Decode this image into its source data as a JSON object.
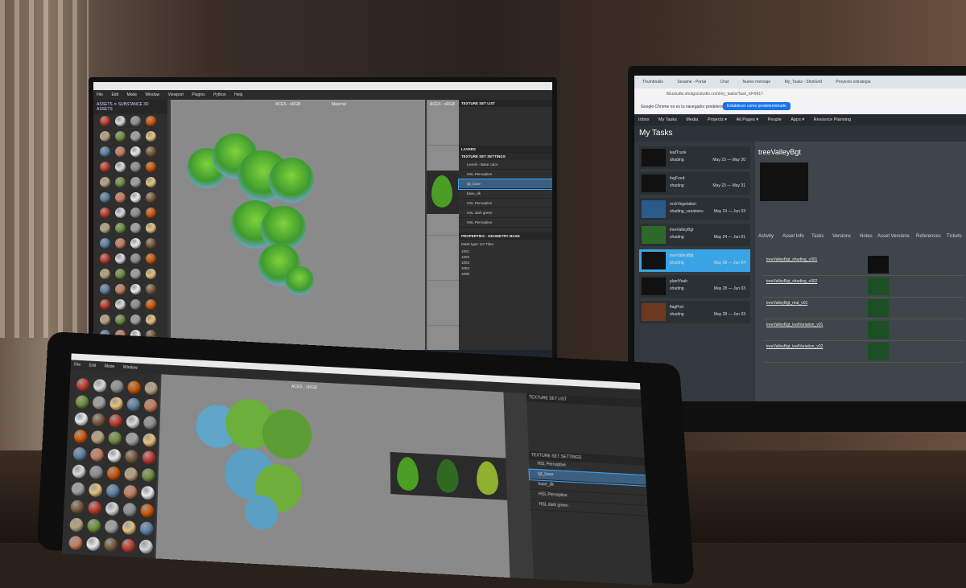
{
  "painter": {
    "menu": [
      "File",
      "Edit",
      "Mode",
      "Window",
      "Viewport",
      "Plugins",
      "Python",
      "Help"
    ],
    "shelf_tabs": "ASSETS ✕   SUBSTANCE 3D ASSETS",
    "panel_titles": {
      "texture_set": "TEXTURE SET LIST",
      "layers": "LAYERS",
      "settings": "TEXTURE SET SETTINGS",
      "properties": "PROPERTIES - GEOMETRY MASK"
    },
    "viewport_label": "ACES - sRGB",
    "view_mode": "Material",
    "layers": [
      {
        "name": "Levels - Base color",
        "selected": false
      },
      {
        "name": "HSL Perceptive",
        "selected": false
      },
      {
        "name": "lgt_base",
        "selected": true
      },
      {
        "name": "base_dk",
        "selected": false
      },
      {
        "name": "HSL Perceptive",
        "selected": false
      },
      {
        "name": "HSL dark green",
        "selected": false
      },
      {
        "name": "HSL Perceptive",
        "selected": false
      }
    ],
    "mesh_type": "Mask type:   UV Tiles",
    "tiles": [
      "1001",
      "1002",
      "1003",
      "1004",
      "1005"
    ]
  },
  "shotgrid": {
    "browser_tabs": [
      "Thumbnails",
      "Sesame - Portal",
      "Chat",
      "Nuevo mensaje",
      "My_Tasks - ShotGrid",
      "Proyecto estrategia"
    ],
    "address": "tblustudio.shotgunstudio.com/my_tasks/Task_Id=9617",
    "infobar_text": "Google Chrome no es tu navegador predeterminado",
    "infobar_button": "Establecer como predeterminado",
    "nav": [
      "Inbox",
      "My Tasks",
      "Media",
      "Projects ▾",
      "All Pages ▾",
      "People",
      "Apps ▾",
      "Resource Planning"
    ],
    "page_title": "My Tasks",
    "entity": "treeValleyBgt",
    "tasks": [
      {
        "name": "leafTrunk",
        "step": "shading",
        "date": "May 23 — May 30"
      },
      {
        "name": "fogFood",
        "step": "shading",
        "date": "May 23 — May 31"
      },
      {
        "name": "rockVegetation",
        "step": "shading_variations",
        "date": "May 24 — Jun 03"
      },
      {
        "name": "treeValleyBgt",
        "step": "shading",
        "date": "May 24 — Jun 01"
      },
      {
        "name": "treeValleyBgt",
        "step": "shading",
        "date": "May 28 — Jun 04"
      },
      {
        "name": "plantYeah",
        "step": "shading",
        "date": "May 28 — Jun 03"
      },
      {
        "name": "flagPod",
        "step": "shading",
        "date": "May 28 — Jun 03"
      }
    ],
    "detail_tabs": [
      "Activity",
      "Asset Info",
      "Tasks",
      "Versions",
      "Notes",
      "Asset Versions",
      "References",
      "Tickets"
    ],
    "versions": [
      "treeValleyBgt_shading_v001",
      "treeValleyBgt_shading_v002",
      "treeValleyBgt_mat_v01",
      "treeValleyBgt_leafVariation_v01",
      "treeValleyBgt_leafVariation_v02"
    ]
  },
  "tablet": {
    "viewport_label": "ACES - sRGB",
    "panel_title": "TEXTURE SET LIST",
    "settings_title": "TEXTURE SET SETTINGS"
  }
}
